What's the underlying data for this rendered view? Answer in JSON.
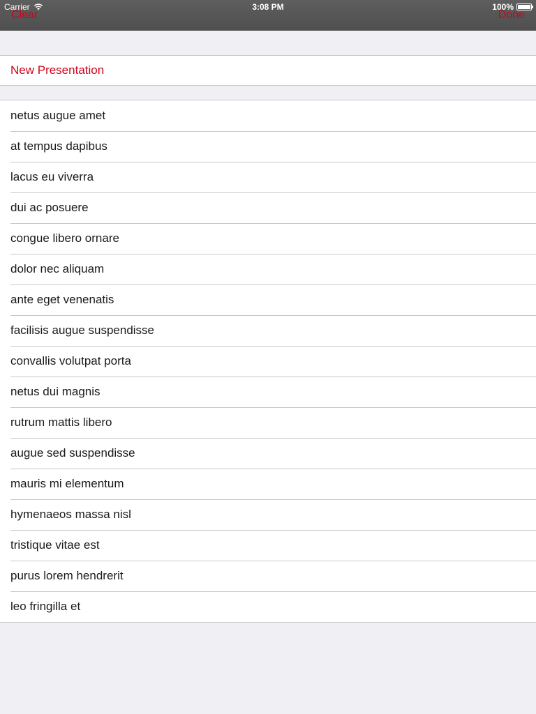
{
  "status_bar": {
    "carrier": "Carrier",
    "time": "3:08 PM",
    "battery": "100%"
  },
  "nav": {
    "left_button": "Clear",
    "right_button": "Done"
  },
  "actions": {
    "new_presentation": "New Presentation"
  },
  "items": [
    "netus augue amet",
    "at tempus dapibus",
    "lacus eu viverra",
    "dui ac posuere",
    "congue libero ornare",
    "dolor nec aliquam",
    "ante eget venenatis",
    "facilisis augue suspendisse",
    "convallis volutpat porta",
    "netus dui magnis",
    "rutrum mattis libero",
    "augue sed suspendisse",
    "mauris mi elementum",
    "hymenaeos massa nisl",
    "tristique vitae est",
    "purus lorem hendrerit",
    "leo fringilla et"
  ],
  "colors": {
    "accent": "#d0021b",
    "background": "#efeff4",
    "separator": "#c8c7cc"
  }
}
